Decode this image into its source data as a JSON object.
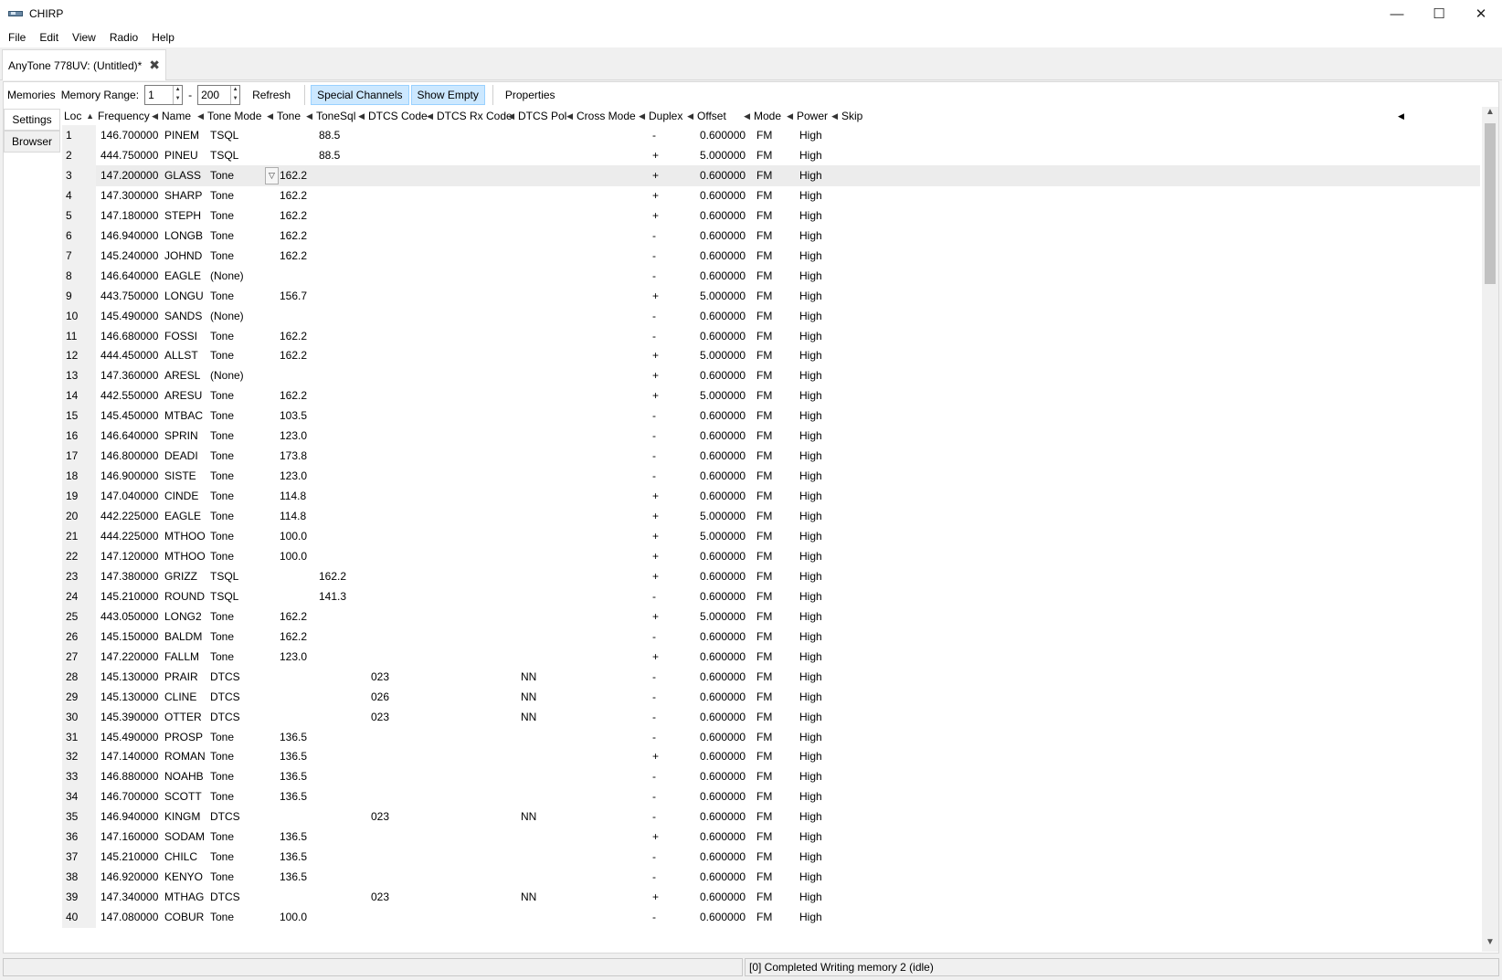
{
  "window": {
    "title": "CHIRP",
    "controls": [
      "—",
      "☐",
      "✕"
    ]
  },
  "menu": [
    "File",
    "Edit",
    "View",
    "Radio",
    "Help"
  ],
  "doc_tab": {
    "label": "AnyTone 778UV: (Untitled)*",
    "close": "✖"
  },
  "toolbar": {
    "memories_label": "Memories",
    "range_label": "Memory Range:",
    "range_start": "1",
    "range_sep": "-",
    "range_end": "200",
    "refresh": "Refresh",
    "special_channels": "Special Channels",
    "show_empty": "Show Empty",
    "properties": "Properties"
  },
  "side_tabs": [
    "Settings",
    "Browser"
  ],
  "columns": [
    "Loc",
    "Frequency",
    "Name",
    "Tone Mode",
    "Tone",
    "ToneSql",
    "DTCS Code",
    "DTCS Rx Code",
    "DTCS Pol",
    "Cross Mode",
    "Duplex",
    "Offset",
    "Mode",
    "Power",
    "Skip"
  ],
  "rows": [
    [
      "1",
      "146.700000",
      "PINEM",
      "TSQL",
      "",
      "88.5",
      "",
      "",
      "",
      "",
      "-",
      "0.600000",
      "FM",
      "High",
      ""
    ],
    [
      "2",
      "444.750000",
      "PINEU",
      "TSQL",
      "",
      "88.5",
      "",
      "",
      "",
      "",
      "+",
      "5.000000",
      "FM",
      "High",
      ""
    ],
    [
      "3",
      "147.200000",
      "GLASS",
      "Tone",
      "162.2",
      "",
      "",
      "",
      "",
      "",
      "+",
      "0.600000",
      "FM",
      "High",
      ""
    ],
    [
      "4",
      "147.300000",
      "SHARP",
      "Tone",
      "162.2",
      "",
      "",
      "",
      "",
      "",
      "+",
      "0.600000",
      "FM",
      "High",
      ""
    ],
    [
      "5",
      "147.180000",
      "STEPH",
      "Tone",
      "162.2",
      "",
      "",
      "",
      "",
      "",
      "+",
      "0.600000",
      "FM",
      "High",
      ""
    ],
    [
      "6",
      "146.940000",
      "LONGB",
      "Tone",
      "162.2",
      "",
      "",
      "",
      "",
      "",
      "-",
      "0.600000",
      "FM",
      "High",
      ""
    ],
    [
      "7",
      "145.240000",
      "JOHND",
      "Tone",
      "162.2",
      "",
      "",
      "",
      "",
      "",
      "-",
      "0.600000",
      "FM",
      "High",
      ""
    ],
    [
      "8",
      "146.640000",
      "EAGLE",
      "(None)",
      "",
      "",
      "",
      "",
      "",
      "",
      "-",
      "0.600000",
      "FM",
      "High",
      ""
    ],
    [
      "9",
      "443.750000",
      "LONGU",
      "Tone",
      "156.7",
      "",
      "",
      "",
      "",
      "",
      "+",
      "5.000000",
      "FM",
      "High",
      ""
    ],
    [
      "10",
      "145.490000",
      "SANDS",
      "(None)",
      "",
      "",
      "",
      "",
      "",
      "",
      "-",
      "0.600000",
      "FM",
      "High",
      ""
    ],
    [
      "11",
      "146.680000",
      "FOSSI",
      "Tone",
      "162.2",
      "",
      "",
      "",
      "",
      "",
      "-",
      "0.600000",
      "FM",
      "High",
      ""
    ],
    [
      "12",
      "444.450000",
      "ALLST",
      "Tone",
      "162.2",
      "",
      "",
      "",
      "",
      "",
      "+",
      "5.000000",
      "FM",
      "High",
      ""
    ],
    [
      "13",
      "147.360000",
      "ARESL",
      "(None)",
      "",
      "",
      "",
      "",
      "",
      "",
      "+",
      "0.600000",
      "FM",
      "High",
      ""
    ],
    [
      "14",
      "442.550000",
      "ARESU",
      "Tone",
      "162.2",
      "",
      "",
      "",
      "",
      "",
      "+",
      "5.000000",
      "FM",
      "High",
      ""
    ],
    [
      "15",
      "145.450000",
      "MTBAC",
      "Tone",
      "103.5",
      "",
      "",
      "",
      "",
      "",
      "-",
      "0.600000",
      "FM",
      "High",
      ""
    ],
    [
      "16",
      "146.640000",
      "SPRIN",
      "Tone",
      "123.0",
      "",
      "",
      "",
      "",
      "",
      "-",
      "0.600000",
      "FM",
      "High",
      ""
    ],
    [
      "17",
      "146.800000",
      "DEADI",
      "Tone",
      "173.8",
      "",
      "",
      "",
      "",
      "",
      "-",
      "0.600000",
      "FM",
      "High",
      ""
    ],
    [
      "18",
      "146.900000",
      "SISTE",
      "Tone",
      "123.0",
      "",
      "",
      "",
      "",
      "",
      "-",
      "0.600000",
      "FM",
      "High",
      ""
    ],
    [
      "19",
      "147.040000",
      "CINDE",
      "Tone",
      "114.8",
      "",
      "",
      "",
      "",
      "",
      "+",
      "0.600000",
      "FM",
      "High",
      ""
    ],
    [
      "20",
      "442.225000",
      "EAGLE",
      "Tone",
      "114.8",
      "",
      "",
      "",
      "",
      "",
      "+",
      "5.000000",
      "FM",
      "High",
      ""
    ],
    [
      "21",
      "444.225000",
      "MTHOO",
      "Tone",
      "100.0",
      "",
      "",
      "",
      "",
      "",
      "+",
      "5.000000",
      "FM",
      "High",
      ""
    ],
    [
      "22",
      "147.120000",
      "MTHOO",
      "Tone",
      "100.0",
      "",
      "",
      "",
      "",
      "",
      "+",
      "0.600000",
      "FM",
      "High",
      ""
    ],
    [
      "23",
      "147.380000",
      "GRIZZ",
      "TSQL",
      "",
      "162.2",
      "",
      "",
      "",
      "",
      "+",
      "0.600000",
      "FM",
      "High",
      ""
    ],
    [
      "24",
      "145.210000",
      "ROUND",
      "TSQL",
      "",
      "141.3",
      "",
      "",
      "",
      "",
      "-",
      "0.600000",
      "FM",
      "High",
      ""
    ],
    [
      "25",
      "443.050000",
      "LONG2",
      "Tone",
      "162.2",
      "",
      "",
      "",
      "",
      "",
      "+",
      "5.000000",
      "FM",
      "High",
      ""
    ],
    [
      "26",
      "145.150000",
      "BALDM",
      "Tone",
      "162.2",
      "",
      "",
      "",
      "",
      "",
      "-",
      "0.600000",
      "FM",
      "High",
      ""
    ],
    [
      "27",
      "147.220000",
      "FALLM",
      "Tone",
      "123.0",
      "",
      "",
      "",
      "",
      "",
      "+",
      "0.600000",
      "FM",
      "High",
      ""
    ],
    [
      "28",
      "145.130000",
      "PRAIR",
      "DTCS",
      "",
      "",
      "023",
      "",
      "NN",
      "",
      "-",
      "0.600000",
      "FM",
      "High",
      ""
    ],
    [
      "29",
      "145.130000",
      "CLINE",
      "DTCS",
      "",
      "",
      "026",
      "",
      "NN",
      "",
      "-",
      "0.600000",
      "FM",
      "High",
      ""
    ],
    [
      "30",
      "145.390000",
      "OTTER",
      "DTCS",
      "",
      "",
      "023",
      "",
      "NN",
      "",
      "-",
      "0.600000",
      "FM",
      "High",
      ""
    ],
    [
      "31",
      "145.490000",
      "PROSP",
      "Tone",
      "136.5",
      "",
      "",
      "",
      "",
      "",
      "-",
      "0.600000",
      "FM",
      "High",
      ""
    ],
    [
      "32",
      "147.140000",
      "ROMAN",
      "Tone",
      "136.5",
      "",
      "",
      "",
      "",
      "",
      "+",
      "0.600000",
      "FM",
      "High",
      ""
    ],
    [
      "33",
      "146.880000",
      "NOAHB",
      "Tone",
      "136.5",
      "",
      "",
      "",
      "",
      "",
      "-",
      "0.600000",
      "FM",
      "High",
      ""
    ],
    [
      "34",
      "146.700000",
      "SCOTT",
      "Tone",
      "136.5",
      "",
      "",
      "",
      "",
      "",
      "-",
      "0.600000",
      "FM",
      "High",
      ""
    ],
    [
      "35",
      "146.940000",
      "KINGM",
      "DTCS",
      "",
      "",
      "023",
      "",
      "NN",
      "",
      "-",
      "0.600000",
      "FM",
      "High",
      ""
    ],
    [
      "36",
      "147.160000",
      "SODAM",
      "Tone",
      "136.5",
      "",
      "",
      "",
      "",
      "",
      "+",
      "0.600000",
      "FM",
      "High",
      ""
    ],
    [
      "37",
      "145.210000",
      "CHILC",
      "Tone",
      "136.5",
      "",
      "",
      "",
      "",
      "",
      "-",
      "0.600000",
      "FM",
      "High",
      ""
    ],
    [
      "38",
      "146.920000",
      "KENYO",
      "Tone",
      "136.5",
      "",
      "",
      "",
      "",
      "",
      "-",
      "0.600000",
      "FM",
      "High",
      ""
    ],
    [
      "39",
      "147.340000",
      "MTHAG",
      "DTCS",
      "",
      "",
      "023",
      "",
      "NN",
      "",
      "+",
      "0.600000",
      "FM",
      "High",
      ""
    ],
    [
      "40",
      "147.080000",
      "COBUR",
      "Tone",
      "100.0",
      "",
      "",
      "",
      "",
      "",
      "-",
      "0.600000",
      "FM",
      "High",
      ""
    ]
  ],
  "selected_row": 2,
  "status": {
    "left": "",
    "right": "[0] Completed Writing memory 2 (idle)"
  }
}
